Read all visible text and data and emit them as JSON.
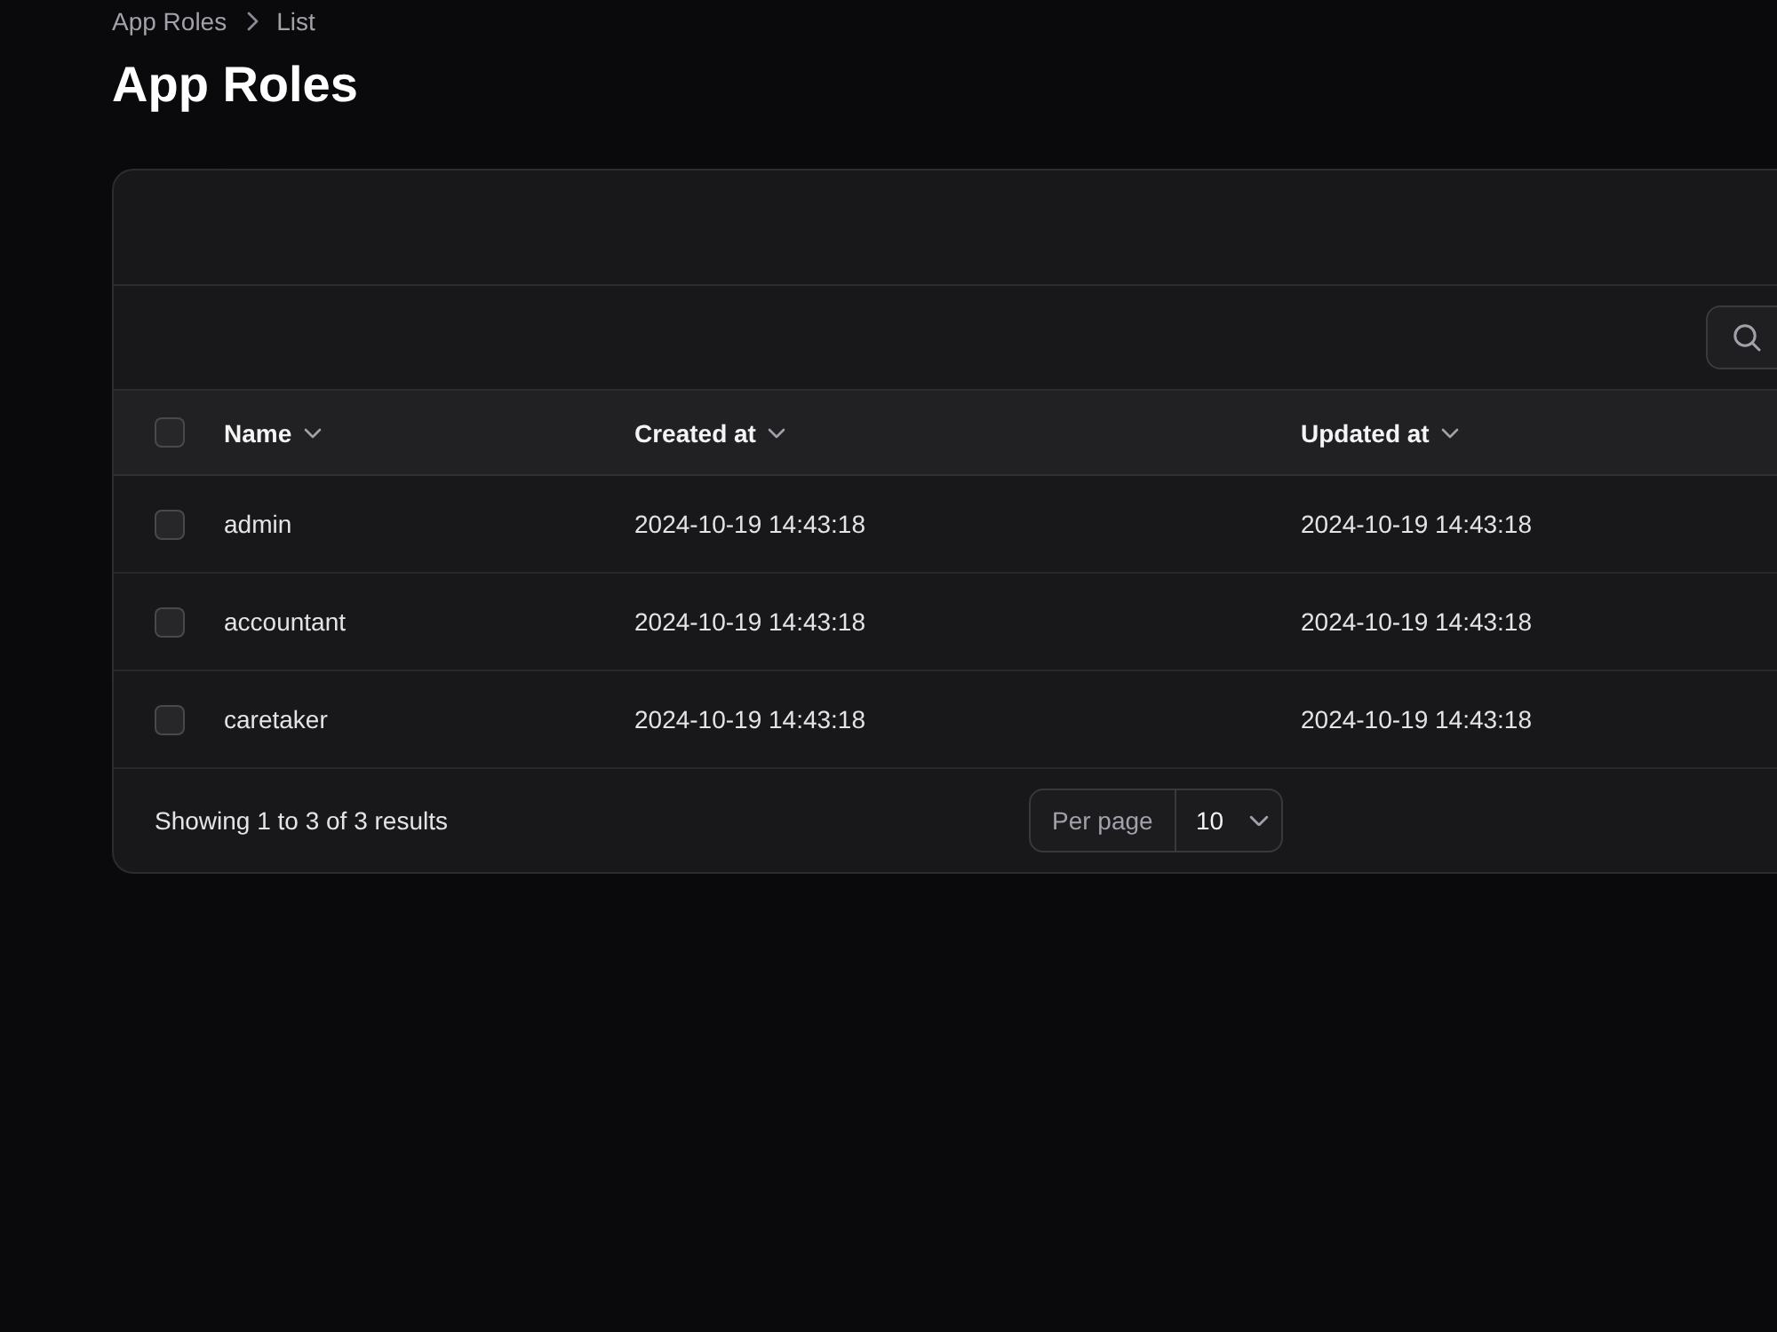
{
  "breadcrumbs": [
    {
      "label": "App Roles"
    },
    {
      "label": "List"
    }
  ],
  "title": "App Roles",
  "table": {
    "select_all": {
      "checked": false
    },
    "columns": [
      {
        "label": "Name",
        "sortable": true
      },
      {
        "label": "Created at",
        "sortable": true
      },
      {
        "label": "Updated at",
        "sortable": true
      }
    ],
    "rows": [
      {
        "checked": false,
        "cells": [
          "admin",
          "2024-10-19 14:43:18",
          "2024-10-19 14:43:18"
        ]
      },
      {
        "checked": false,
        "cells": [
          "accountant",
          "2024-10-19 14:43:18",
          "2024-10-19 14:43:18"
        ]
      },
      {
        "checked": false,
        "cells": [
          "caretaker",
          "2024-10-19 14:43:18",
          "2024-10-19 14:43:18"
        ]
      }
    ],
    "summary": "Showing 1 to 3 of 3 results",
    "per_page": {
      "label": "Per page",
      "value": "10"
    }
  }
}
